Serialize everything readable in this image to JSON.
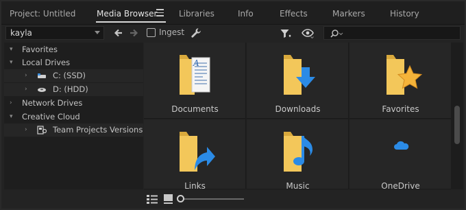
{
  "tabs": [
    {
      "label": "Project: Untitled",
      "active": false
    },
    {
      "label": "Media Browser",
      "active": true
    },
    {
      "label": "Libraries",
      "active": false
    },
    {
      "label": "Info",
      "active": false
    },
    {
      "label": "Effects",
      "active": false
    },
    {
      "label": "Markers",
      "active": false
    },
    {
      "label": "History",
      "active": false
    }
  ],
  "toolbar": {
    "user_select_value": "kayla",
    "ingest_label": "Ingest",
    "ingest_checked": false,
    "search_placeholder": ""
  },
  "tree": {
    "favorites": "Favorites",
    "local_drives": "Local Drives",
    "drive_c": "C: (SSD)",
    "drive_d": "D: (HDD)",
    "network_drives": "Network Drives",
    "creative_cloud": "Creative Cloud",
    "team_projects": "Team Projects Versions"
  },
  "grid": {
    "items": [
      {
        "name": "Documents",
        "icon": "documents-folder-icon"
      },
      {
        "name": "Downloads",
        "icon": "downloads-folder-icon"
      },
      {
        "name": "Favorites",
        "icon": "favorites-folder-icon"
      },
      {
        "name": "Links",
        "icon": "links-folder-icon"
      },
      {
        "name": "Music",
        "icon": "music-folder-icon"
      },
      {
        "name": "OneDrive",
        "icon": "onedrive-cloud-icon"
      }
    ]
  },
  "colors": {
    "folder_yellow": "#f3c75a",
    "folder_shadow": "#d9a93c",
    "accent_blue": "#2b8be6",
    "star_gold": "#f5b43a"
  },
  "zoom_level": 0
}
